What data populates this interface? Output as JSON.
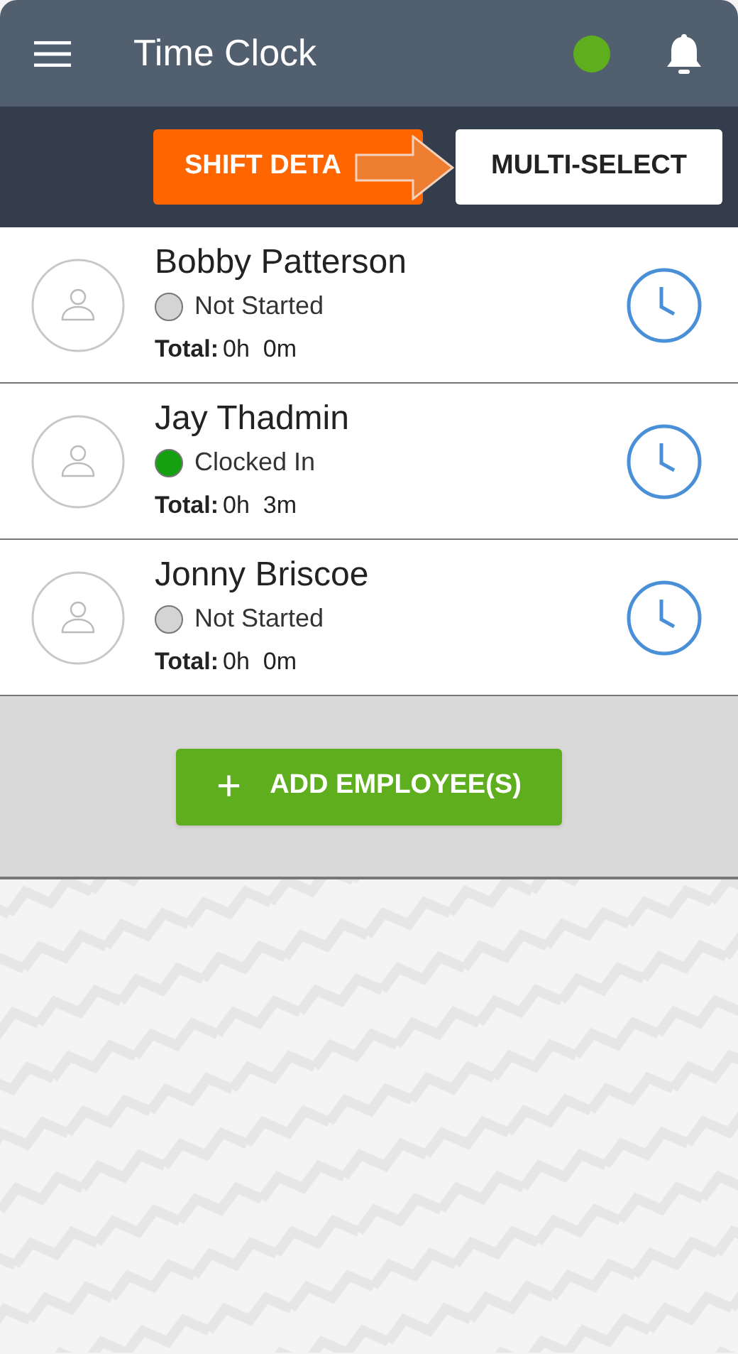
{
  "header": {
    "title": "Time Clock",
    "online": true
  },
  "toolbar": {
    "buttons": [
      {
        "label": "SHIFT DETA",
        "kind": "primary"
      },
      {
        "label": "MULTI-SELECT",
        "kind": "secondary"
      }
    ]
  },
  "employees": [
    {
      "name": "Bobby Patterson",
      "status": "Not Started",
      "color": "#d4d4d4",
      "total_label": "Total:",
      "total": "0h  0m"
    },
    {
      "name": "Jay Thadmin",
      "status": "Clocked In",
      "color": "#15a00f",
      "total_label": "Total:",
      "total": "0h  3m"
    },
    {
      "name": "Jonny Briscoe",
      "status": "Not Started",
      "color": "#d4d4d4",
      "total_label": "Total:",
      "total": "0h  0m"
    }
  ],
  "add_button": {
    "icon": "+",
    "label": "ADD EMPLOYEE(S)"
  }
}
